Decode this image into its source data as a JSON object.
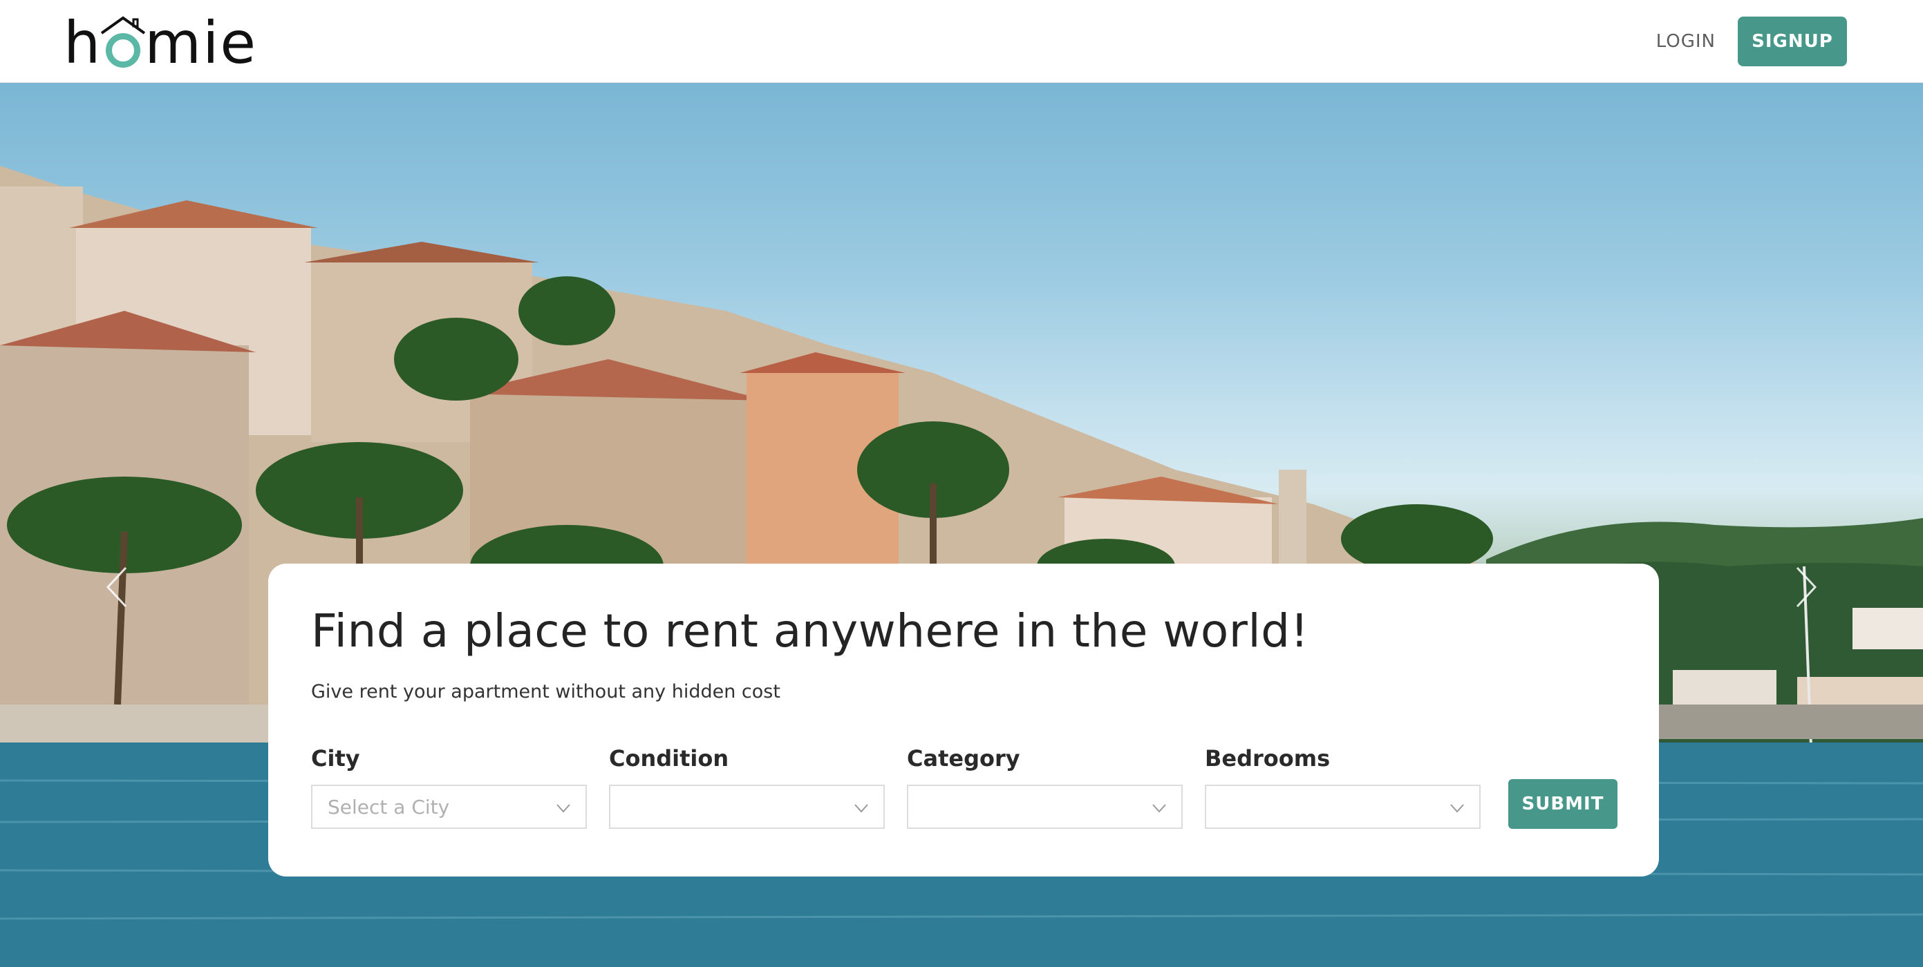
{
  "header": {
    "logo_text": "homie",
    "login_label": "LOGIN",
    "signup_label": "SIGNUP"
  },
  "hero": {
    "title": "Find a place to rent anywhere in the world!",
    "subtitle": "Give rent your apartment without any hidden cost",
    "filters": [
      {
        "label": "City",
        "value": "Select a City"
      },
      {
        "label": "Condition",
        "value": ""
      },
      {
        "label": "Category",
        "value": ""
      },
      {
        "label": "Bedrooms",
        "value": ""
      }
    ],
    "submit_label": "SUBMIT"
  },
  "colors": {
    "accent": "#47988a",
    "logo_accent": "#5bb7a6"
  },
  "icons": {
    "prev": "chevron-left-icon",
    "next": "chevron-right-icon",
    "select": "chevron-down-icon"
  }
}
